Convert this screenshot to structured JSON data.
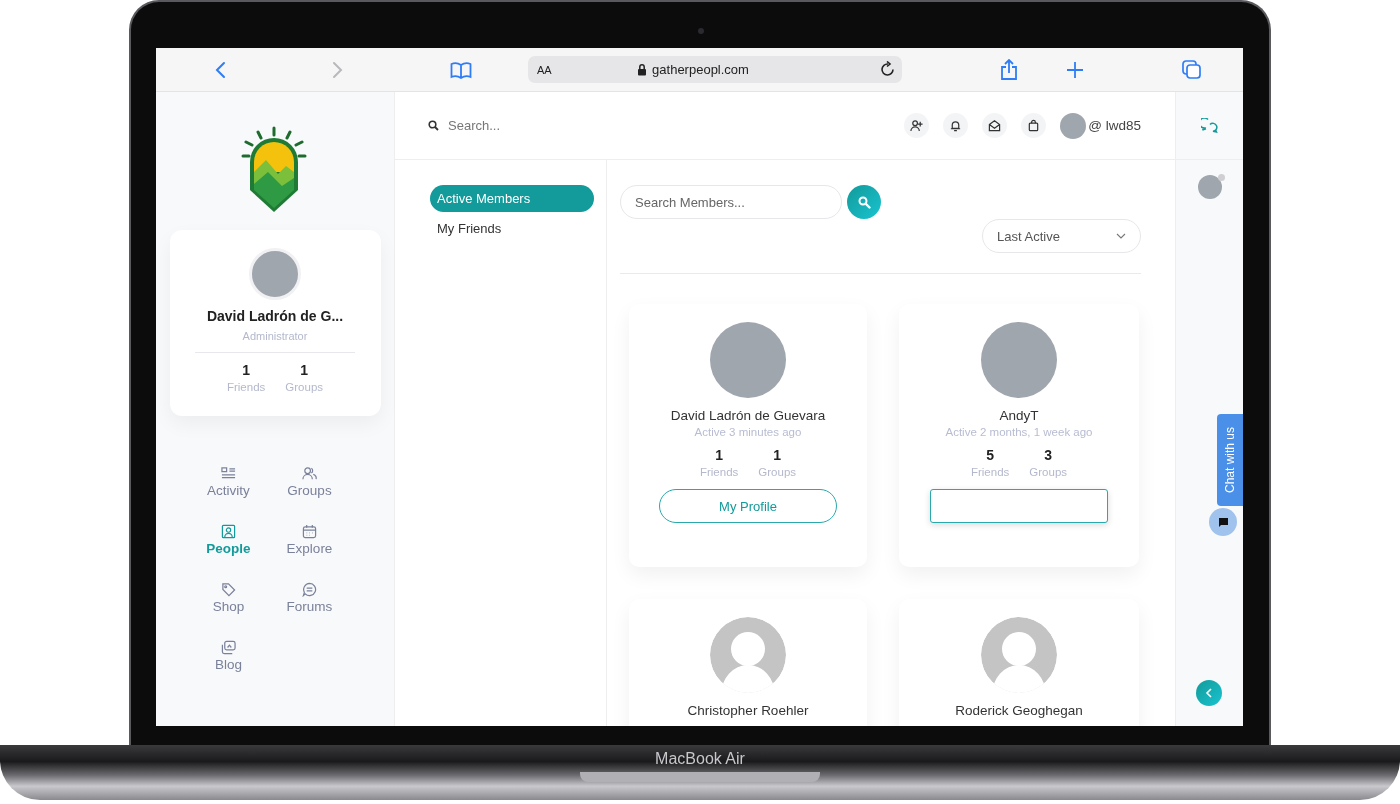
{
  "device": {
    "label": "MacBook Air"
  },
  "browser": {
    "back": {
      "disabled": false
    },
    "forward": {
      "disabled": true
    },
    "text_size": "AA",
    "url": "gatherpeopl.com"
  },
  "sidebar": {
    "profile": {
      "name": "David Ladrón de G...",
      "role": "Administrator",
      "stats": [
        {
          "value": "1",
          "label": "Friends"
        },
        {
          "value": "1",
          "label": "Groups"
        }
      ]
    },
    "nav": [
      {
        "label": "Activity",
        "selected": false
      },
      {
        "label": "Groups",
        "selected": false
      },
      {
        "label": "People",
        "selected": true
      },
      {
        "label": "Explore",
        "selected": false
      },
      {
        "label": "Shop",
        "selected": false
      },
      {
        "label": "Forums",
        "selected": false
      },
      {
        "label": "Blog",
        "selected": false
      }
    ]
  },
  "header": {
    "search": {
      "placeholder": "Search..."
    },
    "username": "@ lwd85"
  },
  "subnav": [
    {
      "label": "Active Members",
      "selected": true
    },
    {
      "label": "My Friends",
      "selected": false
    }
  ],
  "members_search": {
    "placeholder": "Search Members..."
  },
  "sort": {
    "value": "Last Active"
  },
  "members": [
    {
      "name": "David Ladrón de Guevara",
      "kind": "photo",
      "active": "Active 3 minutes ago",
      "stats": [
        {
          "value": "1",
          "label": "Friends"
        },
        {
          "value": "1",
          "label": "Groups"
        }
      ],
      "button": {
        "kind": "rounded",
        "label": "My Profile"
      }
    },
    {
      "name": "AndyT",
      "kind": "photo",
      "active": "Active 2 months, 1 week ago",
      "stats": [
        {
          "value": "5",
          "label": "Friends"
        },
        {
          "value": "3",
          "label": "Groups"
        }
      ],
      "button": {
        "kind": "square"
      }
    },
    {
      "name": "Christopher Roehler",
      "kind": "placeholder"
    },
    {
      "name": "Roderick Geoghegan",
      "kind": "placeholder"
    }
  ],
  "right_rail": {
    "contact": {
      "online": false
    },
    "chat_tab": "Chat with us"
  }
}
